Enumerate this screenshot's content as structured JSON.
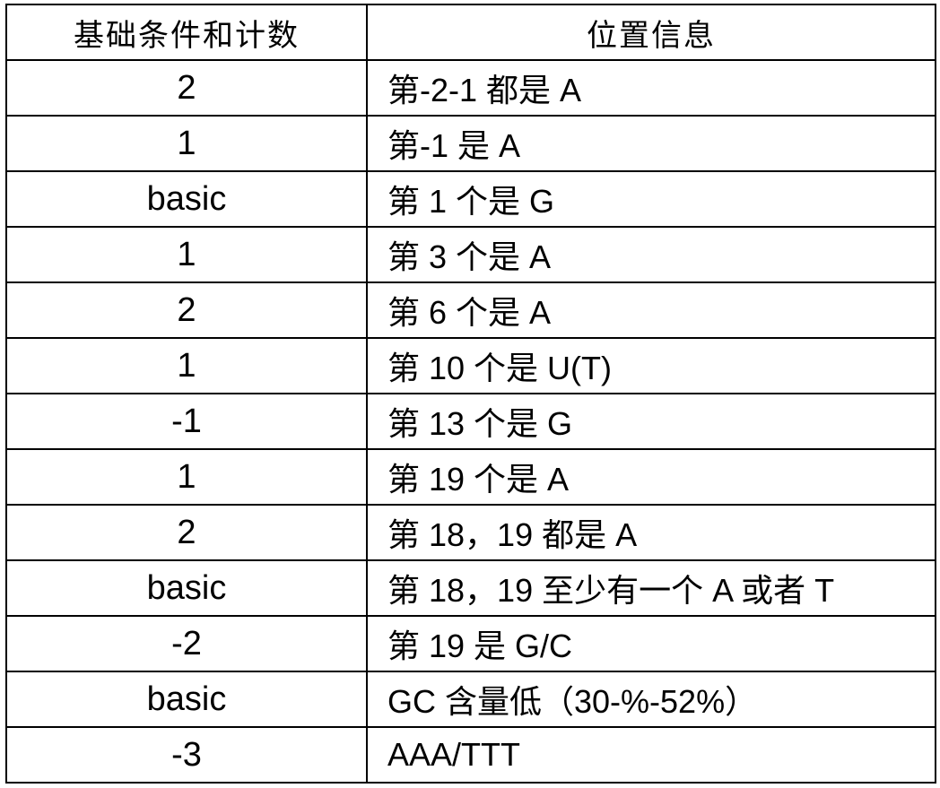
{
  "table": {
    "headers": [
      "基础条件和计数",
      "位置信息"
    ],
    "rows": [
      {
        "count": "2",
        "position": "第-2-1 都是 A"
      },
      {
        "count": "1",
        "position": "第-1 是 A"
      },
      {
        "count": "basic",
        "position": "第 1 个是 G"
      },
      {
        "count": "1",
        "position": "第 3 个是 A"
      },
      {
        "count": "2",
        "position": "第 6 个是 A"
      },
      {
        "count": "1",
        "position": "第 10 个是 U(T)"
      },
      {
        "count": "-1",
        "position": "第 13 个是 G"
      },
      {
        "count": "1",
        "position": "第 19 个是 A"
      },
      {
        "count": "2",
        "position": "第 18，19 都是 A"
      },
      {
        "count": "basic",
        "position": "第 18，19 至少有一个 A 或者 T"
      },
      {
        "count": "-2",
        "position": "第 19 是 G/C"
      },
      {
        "count": "basic",
        "position": "GC 含量低（30-%-52%）"
      },
      {
        "count": "-3",
        "position": "AAA/TTT"
      }
    ]
  }
}
